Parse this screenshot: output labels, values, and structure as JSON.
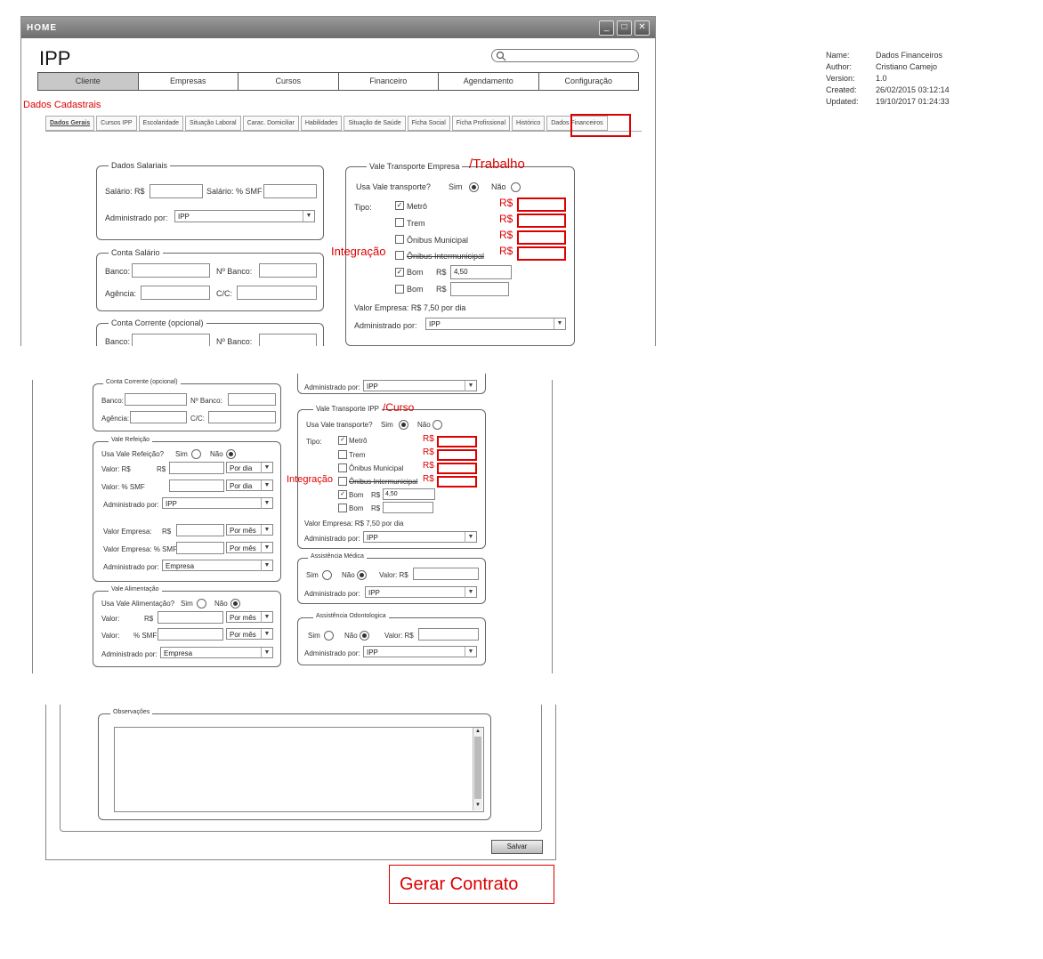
{
  "window": {
    "title": "HOME",
    "logo": "IPP"
  },
  "nav": [
    "Cliente",
    "Empresas",
    "Cursos",
    "Financeiro",
    "Agendamento",
    "Configuração"
  ],
  "annotations": {
    "dados_cadastrais": "Dados Cadastrais",
    "trabalho": "/Trabalho",
    "curso": "/Curso",
    "integracao": "Integração",
    "rs": "R$",
    "gerar_contrato": "Gerar Contrato"
  },
  "tabs": [
    "Dados Gerais",
    "Cursos IPP",
    "Escolaridade",
    "Situação Laboral",
    "Carac. Domiciliar",
    "Habilidades",
    "Situação de Saúde",
    "Ficha Social",
    "Ficha Profissional",
    "Histórico",
    "Dados Financeiros"
  ],
  "meta": {
    "name_k": "Name:",
    "name_v": "Dados Financeiros",
    "author_k": "Author:",
    "author_v": "Cristiano Camejo",
    "version_k": "Version:",
    "version_v": "1.0",
    "created_k": "Created:",
    "created_v": "26/02/2015 03:12:14",
    "updated_k": "Updated:",
    "updated_v": "19/10/2017 01:24:33"
  },
  "dados_salariais": {
    "legend": "Dados Salariais",
    "salario_rs": "Salário: R$",
    "salario_smf": "Salário: % SMF",
    "administrado_por": "Administrado por:",
    "admin_value": "IPP"
  },
  "conta_salario": {
    "legend": "Conta Salário",
    "banco": "Banco:",
    "n_banco": "Nº Banco:",
    "agencia": "Agência:",
    "cc": "C/C:"
  },
  "conta_corrente": {
    "legend": "Conta Corrente (opcional)",
    "banco": "Banco:",
    "n_banco": "Nº Banco:",
    "agencia": "Agência:",
    "cc": "C/C:"
  },
  "vt_empresa": {
    "legend": "Vale Transporte Empresa",
    "usa": "Usa Vale transporte?",
    "sim": "Sim",
    "nao": "Não",
    "tipo": "Tipo:",
    "metro": "Metrô",
    "trem": "Trem",
    "onibus_mun": "Ônibus Municipal",
    "onibus_int": "Ônibus Intermunicipal",
    "bom1": "Bom",
    "bom2": "Bom",
    "rs": "R$",
    "bom_value": "4,50",
    "valor_empresa": "Valor Empresa: R$ 7,50 por dia",
    "administrado_por": "Administrado por:",
    "admin_value": "IPP"
  },
  "bottom_left": {
    "conta_corrente": {
      "legend": "Conta Corrente (opcional)",
      "banco": "Banco:",
      "n_banco": "Nº Banco:",
      "agencia": "Agência:",
      "cc": "C/C:"
    },
    "vale_refeicao": {
      "legend": "Vale Refeição",
      "usa": "Usa Vale Refeição?",
      "sim": "Sim",
      "nao": "Não",
      "valor_rs": "Valor: R$",
      "rs": "R$",
      "valor_smf": "Valor: % SMF",
      "por_dia": "Por dia",
      "administrado_por": "Administrado por:",
      "admin_value": "IPP",
      "valor_empresa": "Valor Empresa:",
      "rs2": "R$",
      "por_mes": "Por mês",
      "valor_empresa_smf": "Valor Empresa: % SMF",
      "por_mes2": "Por mês",
      "administrado_por2": "Administrado por:",
      "admin_value2": "Empresa"
    },
    "vale_alimentacao": {
      "legend": "Vale Alimentação",
      "usa": "Usa Vale Alimentação?",
      "sim": "Sim",
      "nao": "Não",
      "valor": "Valor:",
      "rs": "R$",
      "por_mes": "Por mês",
      "valor_smf": "Valor:",
      "smf": "% SMF",
      "por_mes2": "Por mês",
      "administrado_por": "Administrado por:",
      "admin_value": "Empresa"
    }
  },
  "bottom_right": {
    "administrado_por": "Administrado por:",
    "admin_value": "IPP",
    "vt_ipp": {
      "legend": "Vale Transporte IPP",
      "usa": "Usa Vale transporte?",
      "sim": "Sim",
      "nao": "Não",
      "tipo": "Tipo:",
      "metro": "Metrô",
      "trem": "Trem",
      "onibus_mun": "Ônibus Municipal",
      "onibus_int": "Ônibus Intermunicipal",
      "bom1": "Bom",
      "bom2": "Bom",
      "rs": "R$",
      "bom_value": "4,50",
      "valor_empresa": "Valor Empresa: R$ 7,50 por dia",
      "administrado_por": "Administrado por:",
      "admin_value": "IPP"
    },
    "assist_medica": {
      "legend": "Assistência Médica",
      "sim": "Sim",
      "nao": "Não",
      "valor": "Valor: R$",
      "administrado_por": "Administrado por:",
      "admin_value": "IPP"
    },
    "assist_odonto": {
      "legend": "Assistência Odontologica",
      "sim": "Sim",
      "nao": "Não",
      "valor": "Valor: R$",
      "administrado_por": "Administrado por:",
      "admin_value": "IPP"
    }
  },
  "observacoes": {
    "legend": "Observações",
    "salvar": "Salvar"
  }
}
